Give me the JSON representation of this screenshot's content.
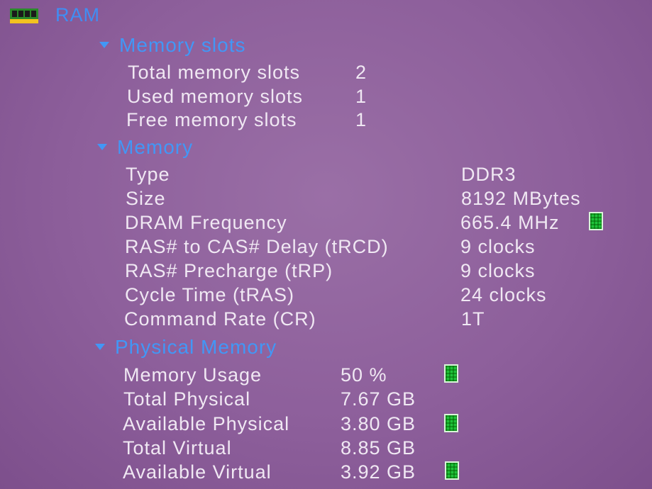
{
  "header": {
    "title": "RAM",
    "icon": "ram-module-icon"
  },
  "memory_slots": {
    "heading": "Memory slots",
    "rows": [
      {
        "label": "Total memory slots",
        "value": "2"
      },
      {
        "label": "Used memory slots",
        "value": "1"
      },
      {
        "label": "Free memory slots",
        "value": "1"
      }
    ]
  },
  "memory": {
    "heading": "Memory",
    "rows": [
      {
        "label": "Type",
        "value": "DDR3"
      },
      {
        "label": "Size",
        "value": "8192 MBytes"
      },
      {
        "label": "DRAM Frequency",
        "value": "665.4 MHz"
      },
      {
        "label": "RAS# to CAS# Delay (tRCD)",
        "value": "9 clocks"
      },
      {
        "label": "RAS# Precharge (tRP)",
        "value": "9 clocks"
      },
      {
        "label": "Cycle Time (tRAS)",
        "value": "24 clocks"
      },
      {
        "label": "Command Rate (CR)",
        "value": "1T"
      }
    ]
  },
  "physical_memory": {
    "heading": "Physical Memory",
    "rows": [
      {
        "label": "Memory Usage",
        "value": "50 %"
      },
      {
        "label": "Total Physical",
        "value": "7.67 GB"
      },
      {
        "label": "Available Physical",
        "value": "3.80 GB"
      },
      {
        "label": "Total Virtual",
        "value": "8.85 GB"
      },
      {
        "label": "Available Virtual",
        "value": "3.92 GB"
      }
    ]
  },
  "colors": {
    "heading": "#4297f6",
    "text": "#f0e8f3",
    "indicator": "#1fc33a"
  }
}
